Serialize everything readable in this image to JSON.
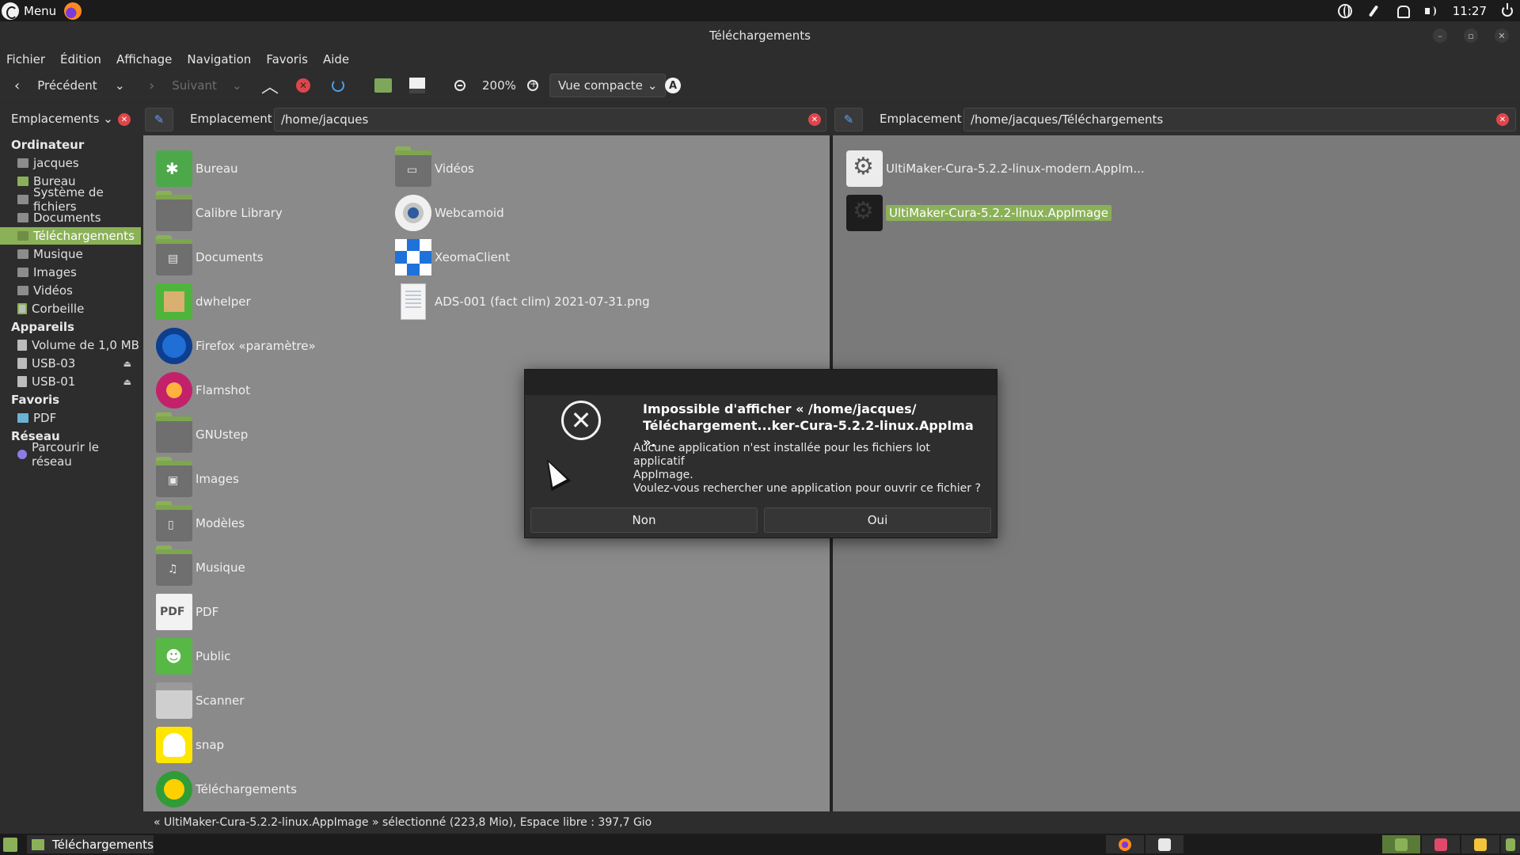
{
  "top_panel": {
    "menu_label": "Menu",
    "clock": "11:27",
    "tray_icons": [
      "globe-icon",
      "link-icon",
      "bell-icon",
      "sound-icon",
      "power-icon"
    ]
  },
  "window": {
    "title": "Téléchargements"
  },
  "menubar": [
    "Fichier",
    "Édition",
    "Affichage",
    "Navigation",
    "Favoris",
    "Aide"
  ],
  "toolbar": {
    "back_label": "Précédent",
    "forward_label": "Suivant",
    "zoom_level": "200%",
    "view_mode": "Vue compacte"
  },
  "sidebar": {
    "header": "Emplacements",
    "sections": {
      "computer": "Ordinateur",
      "devices": "Appareils",
      "favorites": "Favoris",
      "network": "Réseau"
    },
    "items": [
      "jacques",
      "Bureau",
      "Système de fichiers",
      "Documents",
      "Téléchargements",
      "Musique",
      "Images",
      "Vidéos",
      "Corbeille"
    ],
    "devices": [
      "Volume de 1,0 MB",
      "USB-03",
      "USB-01"
    ],
    "favorites": [
      "PDF"
    ],
    "network": [
      "Parcourir le réseau"
    ]
  },
  "left_pane": {
    "location_label": "Emplacement :",
    "path": "/home/jacques",
    "items": [
      "Bureau",
      "Calibre Library",
      "Documents",
      "dwhelper",
      "Firefox «paramètre»",
      "Flamshot",
      "GNUstep",
      "Images",
      "Modèles",
      "Musique",
      "PDF",
      "Public",
      "Scanner",
      "snap",
      "Téléchargements",
      "Vidéos",
      "Webcamoid",
      "XeomaClient",
      "ADS-001 (fact clim) 2021-07-31.png"
    ]
  },
  "right_pane": {
    "location_label": "Emplacement :",
    "path": "/home/jacques/Téléchargements",
    "items": [
      "UltiMaker-Cura-5.2.2-linux-modern.AppIm...",
      "UltiMaker-Cura-5.2.2-linux.AppImage"
    ]
  },
  "dialog": {
    "title_line1": "Impossible d'afficher « /home/jacques/",
    "title_line2": "Téléchargement...ker-Cura-5.2.2-linux.AppIma ».",
    "message_line1": "Aucune application n'est installée pour les fichiers lot applicatif",
    "message_line2": "AppImage.",
    "message_line3": "Voulez-vous rechercher une application pour ouvrir ce fichier ?",
    "no_label": "Non",
    "yes_label": "Oui"
  },
  "statusbar": {
    "text": "« UltiMaker-Cura-5.2.2-linux.AppImage » sélectionné (223,8 Mio), Espace libre : 397,7 Gio"
  },
  "taskbar": {
    "window_label": "Téléchargements"
  },
  "colors": {
    "accent": "#8bb158",
    "error": "#e0454a"
  }
}
